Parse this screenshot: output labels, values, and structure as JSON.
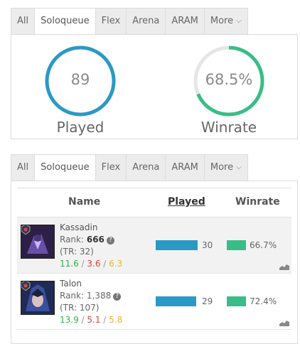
{
  "tabs": [
    "All",
    "Soloqueue",
    "Flex",
    "Arena",
    "ARAM",
    "More"
  ],
  "active_tab": "Soloqueue",
  "summary": {
    "played": {
      "value": "89",
      "label": "Played",
      "fraction": 1.0,
      "color": "#2b99c6"
    },
    "winrate": {
      "value": "68.5%",
      "label": "Winrate",
      "fraction": 0.685,
      "color": "#39bd86"
    }
  },
  "table": {
    "headers": {
      "name": "Name",
      "played": "Played",
      "winrate": "Winrate"
    },
    "rows": [
      {
        "name": "Kassadin",
        "rank_label": "Rank:",
        "rank": "666",
        "tr": "(TR: 32)",
        "kills": "11.6",
        "deaths": "3.6",
        "assists": "6.3",
        "played": "30",
        "played_fraction": 1.0,
        "winrate": "66.7%",
        "winrate_fraction": 0.667
      },
      {
        "name": "Talon",
        "rank_label": "Rank:",
        "rank": "1,388",
        "tr": "(TR: 107)",
        "kills": "13.9",
        "deaths": "5.1",
        "assists": "5.8",
        "played": "29",
        "played_fraction": 0.967,
        "winrate": "72.4%",
        "winrate_fraction": 0.724
      }
    ]
  },
  "icons": {
    "help": "question-circle-icon",
    "chevron": "chevron-down-icon",
    "trend": "area-chart-icon",
    "rank": "rank-emblem-icon"
  }
}
